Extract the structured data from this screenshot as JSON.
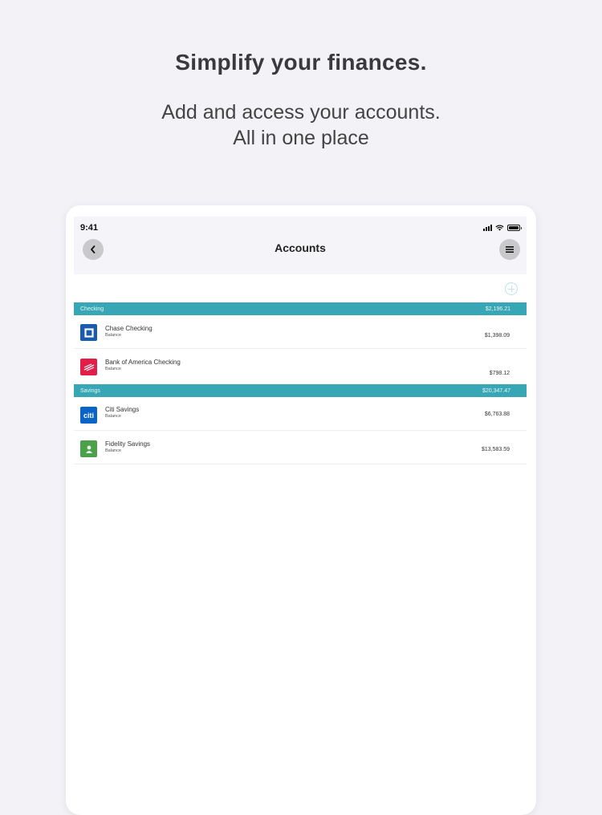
{
  "promo": {
    "headline": "Simplify your finances.",
    "subline_1": "Add and access your accounts.",
    "subline_2": "All in one place"
  },
  "status_bar": {
    "time": "9:41"
  },
  "nav": {
    "title": "Accounts",
    "back_icon": "chevron-left-icon",
    "menu_icon": "hamburger-icon"
  },
  "add_icon": "plus-circle-icon",
  "colors": {
    "section": "#37a7b6",
    "background": "#f3f2f7"
  },
  "sections": [
    {
      "label": "Checking",
      "total": "$2,196.21",
      "accounts": [
        {
          "name": "Chase Checking",
          "sub": "Balance",
          "amount": "$1,398.09",
          "logo": "chase-logo-icon"
        },
        {
          "name": "Bank of America Checking",
          "sub": "Balance",
          "amount": "$798.12",
          "logo": "bank-of-america-logo-icon"
        }
      ]
    },
    {
      "label": "Savings",
      "total": "$20,347.47",
      "accounts": [
        {
          "name": "Citi Savings",
          "sub": "Balance",
          "amount": "$6,763.88",
          "logo": "citi-logo-icon",
          "logo_text": "citi"
        },
        {
          "name": "Fidelity Savings",
          "sub": "Balance",
          "amount": "$13,583.59",
          "logo": "fidelity-logo-icon"
        }
      ]
    }
  ]
}
